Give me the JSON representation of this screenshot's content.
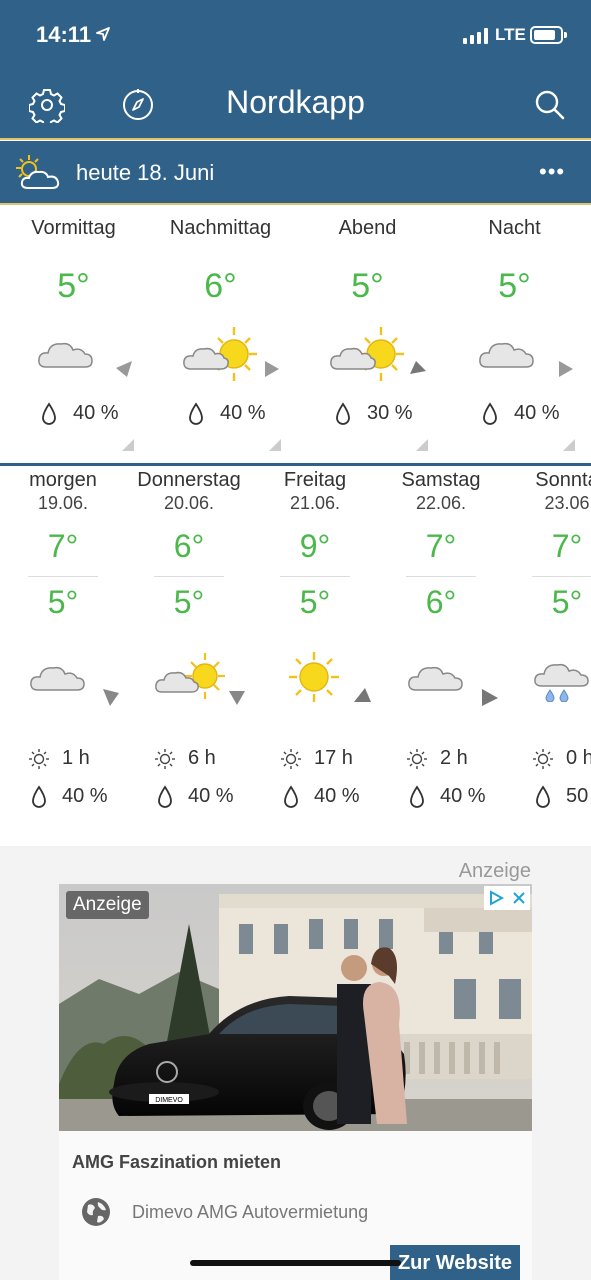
{
  "status": {
    "time": "14:11",
    "network": "LTE"
  },
  "nav": {
    "title": "Nordkapp"
  },
  "day_header": {
    "label": "heute 18. Juni",
    "more": "•••"
  },
  "today": [
    {
      "label": "Vormittag",
      "temp": "5°",
      "icon": "cloud-icon",
      "rain": "40 %"
    },
    {
      "label": "Nachmittag",
      "temp": "6°",
      "icon": "sun-cloud-icon",
      "rain": "40 %"
    },
    {
      "label": "Abend",
      "temp": "5°",
      "icon": "sun-cloud-icon",
      "rain": "30 %"
    },
    {
      "label": "Nacht",
      "temp": "5°",
      "icon": "cloud-icon",
      "rain": "40 %"
    }
  ],
  "forecast": [
    {
      "name": "morgen",
      "date": "19.06.",
      "hi": "7°",
      "lo": "5°",
      "icon": "cloud-icon",
      "sun": "1 h",
      "rain": "40 %"
    },
    {
      "name": "Donnerstag",
      "date": "20.06.",
      "hi": "6°",
      "lo": "5°",
      "icon": "sun-cloud-icon",
      "sun": "6 h",
      "rain": "40 %"
    },
    {
      "name": "Freitag",
      "date": "21.06.",
      "hi": "9°",
      "lo": "5°",
      "icon": "sun-icon",
      "sun": "17 h",
      "rain": "40 %"
    },
    {
      "name": "Samstag",
      "date": "22.06.",
      "hi": "7°",
      "lo": "6°",
      "icon": "cloud-icon",
      "sun": "2 h",
      "rain": "40 %"
    },
    {
      "name": "Sonnta",
      "date": "23.06",
      "hi": "7°",
      "lo": "5°",
      "icon": "rain-cloud-icon",
      "sun": "0 h",
      "rain": "50"
    }
  ],
  "ad": {
    "label": "Anzeige",
    "tag": "Anzeige",
    "title": "AMG Faszination mieten",
    "sponsor": "Dimevo AMG Autovermietung",
    "cta": "Zur Website",
    "plate": "DIMEVO"
  },
  "colors": {
    "header": "#2f6189",
    "accent_line": "#e2c36a",
    "temp": "#4bb84b",
    "sun": "#f7d81c"
  }
}
